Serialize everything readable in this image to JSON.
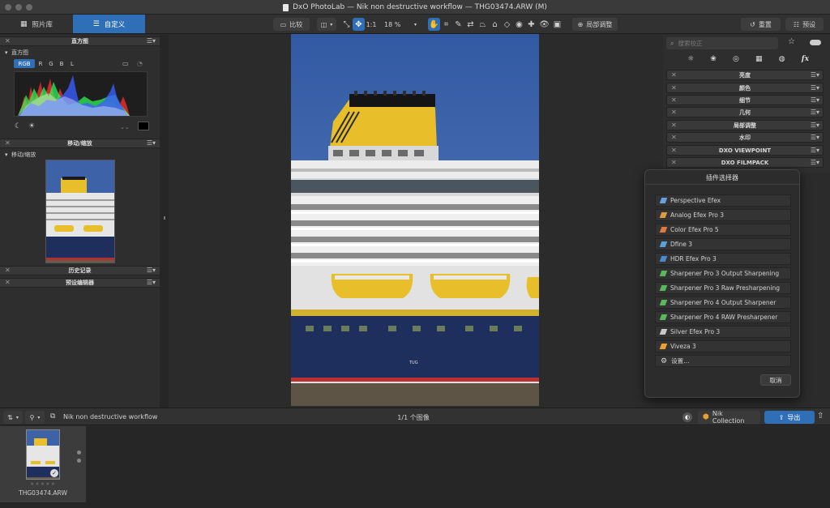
{
  "window": {
    "title": "DxO PhotoLab — Nik non destructive workflow — THG03474.ARW (M)"
  },
  "toolbar": {
    "tab_library": "照片库",
    "tab_customize": "自定义",
    "compare_label": "比较",
    "zoom_one": "1:1",
    "zoom_value": "18 %",
    "local_adjust_label": "局部调整",
    "reset_label": "重置",
    "presets_label": "预设"
  },
  "left_panel": {
    "histogram_header": "直方图",
    "histogram_sub": "直方图",
    "channels": [
      "RGB",
      "R",
      "G",
      "B",
      "L"
    ],
    "move_zoom_header": "移动/缩放",
    "move_zoom_sub": "移动/缩放",
    "history_header": "历史记录",
    "preset_editor_header": "预设编辑器"
  },
  "right_panel": {
    "search_placeholder": "搜索校正",
    "fx_label": "fx",
    "sections": [
      "亮度",
      "颜色",
      "细节",
      "几何",
      "局部调整",
      "水印",
      "DXO VIEWPOINT",
      "DXO FILMPACK"
    ]
  },
  "plugin_popup": {
    "title": "插件选择器",
    "items": [
      "Perspective Efex",
      "Analog Efex Pro 3",
      "Color Efex Pro 5",
      "Dfine 3",
      "HDR Efex Pro 3",
      "Sharpener Pro 3 Output Sharpening",
      "Sharpener Pro 3 Raw Presharpening",
      "Sharpener Pro 4 Output Sharpener",
      "Sharpener Pro 4 RAW Presharpener",
      "Silver Efex Pro 3",
      "Viveza 3"
    ],
    "settings_label": "设置…",
    "cancel_label": "取消"
  },
  "photo": {
    "hull_text": "TUG"
  },
  "bottom_bar": {
    "project_name": "Nik non destructive workflow",
    "image_count": "1/1 个图像",
    "nik_label": "Nik Collection",
    "export_label": "导出"
  },
  "filmstrip": {
    "filename": "THG03474.ARW",
    "rating": "★★★★★"
  },
  "colors": {
    "accent_blue": "#2e6fb8",
    "panel_bg": "#2e2e2e",
    "funnel_yellow": "#e8bf2a",
    "hull_blue": "#1e2f5e",
    "sky_blue": "#3d62a8"
  }
}
